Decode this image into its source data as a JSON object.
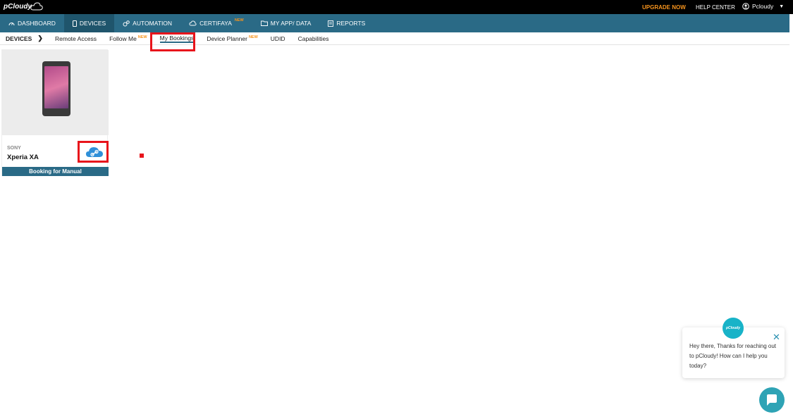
{
  "topbar": {
    "logo": "pCloudy",
    "upgrade": "UPGRADE NOW",
    "help": "HELP CENTER",
    "user": "Pcloudy"
  },
  "mainnav": [
    {
      "label": "DASHBOARD",
      "icon": "gauge-icon"
    },
    {
      "label": "DEVICES",
      "icon": "phone-icon",
      "active": true
    },
    {
      "label": "AUTOMATION",
      "icon": "gears-icon"
    },
    {
      "label": "CERTIFAYA",
      "icon": "cloud-icon",
      "badge": "NEW"
    },
    {
      "label": "MY APP/ DATA",
      "icon": "folder-icon"
    },
    {
      "label": "REPORTS",
      "icon": "document-icon"
    }
  ],
  "subnav": {
    "title": "DEVICES",
    "items": [
      {
        "label": "Remote Access"
      },
      {
        "label": "Follow Me",
        "badge": "NEW"
      },
      {
        "label": "My Bookings",
        "active": true
      },
      {
        "label": "Device Planner",
        "badge": "NEW"
      },
      {
        "label": "UDID"
      },
      {
        "label": "Capabilities"
      }
    ]
  },
  "device_card": {
    "brand": "SONY",
    "model": "Xperia XA",
    "booking": "Booking for Manual"
  },
  "chat": {
    "avatar": "pCloudy",
    "message": "Hey there, Thanks for reaching out to pCloudy! How can I help you today?"
  },
  "colors": {
    "nav": "#2a6a86",
    "accent_orange": "#f7941d",
    "highlight_red": "#e8141b",
    "chat_teal": "#2ea3b5"
  }
}
